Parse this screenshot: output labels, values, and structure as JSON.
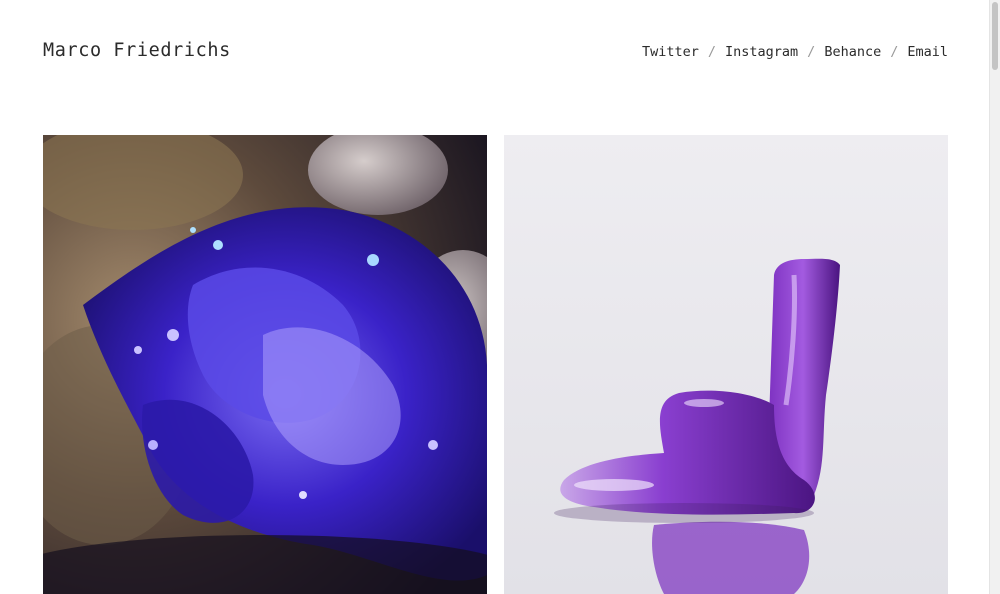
{
  "header": {
    "site_title": "Marco Friedrichs",
    "nav": {
      "twitter": "Twitter",
      "instagram": "Instagram",
      "behance": "Behance",
      "email": "Email",
      "separator": "/"
    }
  },
  "gallery": {
    "items": [
      {
        "image": "purple-glass-splash-artwork",
        "accent": "#3a22c8"
      },
      {
        "image": "purple-liquid-melt-artwork",
        "accent": "#8a3fd0"
      }
    ],
    "background": "#eeedf1"
  }
}
